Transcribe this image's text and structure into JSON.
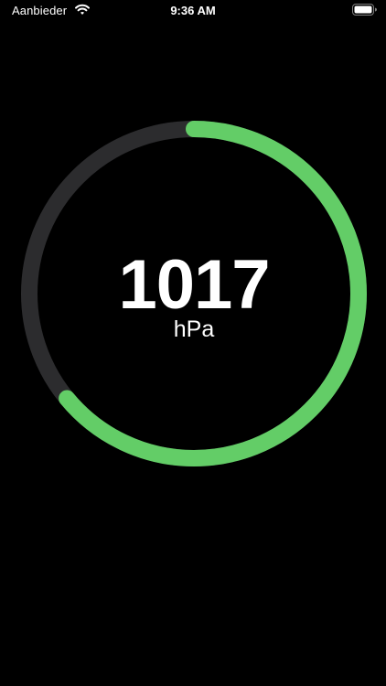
{
  "status_bar": {
    "carrier": "Aanbieder",
    "time": "9:36 AM",
    "wifi_icon": "wifi-icon",
    "battery_icon": "battery-icon"
  },
  "gauge": {
    "value": "1017",
    "unit": "hPa",
    "fraction": 0.64,
    "track_color": "#2c2c2e",
    "progress_color": "#63cd67"
  }
}
